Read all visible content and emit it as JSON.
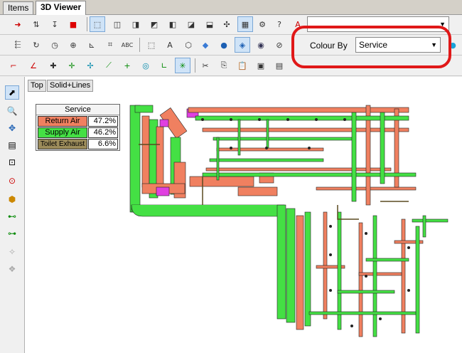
{
  "tabs": [
    {
      "label": "Items"
    },
    {
      "label": "3D Viewer"
    }
  ],
  "colour_by": {
    "label": "Colour By",
    "value": "Service",
    "highlight_color": "#e01818"
  },
  "view_buttons": {
    "top": "Top",
    "mode": "Solid+Lines"
  },
  "legend": {
    "title": "Service",
    "items": [
      {
        "name": "Return Air",
        "percent": "47.2%",
        "color": "#f08060"
      },
      {
        "name": "Supply Air",
        "percent": "46.2%",
        "color": "#44e044"
      },
      {
        "name": "Toilet Exhaust",
        "percent": "6.6%",
        "color": "#9b8b5a"
      }
    ]
  },
  "colors": {
    "return_air": "#f08060",
    "supply_air": "#44e044",
    "toilet_exhaust": "#9b8b5a",
    "fitting": "#e040e0"
  },
  "icons": {
    "row1": [
      "red-arrow-icon",
      "sort-icon",
      "sort-desc-icon",
      "red-block-icon",
      "cube-outline-icon",
      "cube-front-icon",
      "cube-side-icon",
      "cube-top-icon",
      "cube-iso-icon",
      "cube-alt-icon",
      "axis-icon",
      "layers-icon",
      "help-icon",
      "paint-icon"
    ],
    "row2": [
      "select-icon",
      "rotate-icon",
      "spin-icon",
      "pan-icon",
      "zoom-axis-icon",
      "abc-label-icon",
      "box-icon",
      "text-a-icon",
      "wire-cube-icon",
      "blue-cube-icon",
      "sphere-icon",
      "shaded-cube-icon",
      "globe-icon",
      "clear-icon"
    ],
    "row3": [
      "line-tool-icon",
      "angle-tool-icon",
      "cross-icon",
      "node-icon",
      "split-icon",
      "diagonal-icon",
      "plus-icon",
      "target-icon",
      "corner-icon",
      "snap-icon",
      "cut-icon",
      "copy-icon",
      "paste-icon",
      "view-3d-icon",
      "export-icon"
    ],
    "left": [
      "cursor-icon",
      "zoom-icon",
      "move-icon",
      "properties-icon",
      "fit-icon",
      "zoom-region-icon",
      "component-icon",
      "connect-icon",
      "add-pipe-icon",
      "disabled-tool-icon",
      "disabled-camera-icon"
    ]
  },
  "row1_labels": {
    "abc": "ABC"
  }
}
